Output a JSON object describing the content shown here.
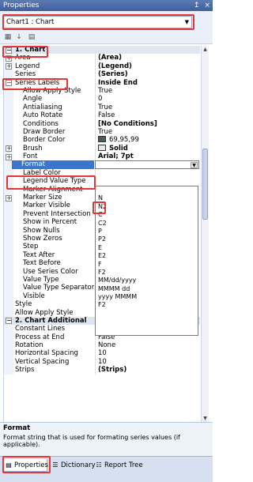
{
  "window": {
    "title": "Properties",
    "pin_glyph": "↥",
    "close_glyph": "×"
  },
  "object_selector": {
    "value": "Chart1 : Chart",
    "arrow_glyph": "▼"
  },
  "toolbar": {
    "icons": [
      "categorized-icon",
      "alphabetical-icon",
      "property-pages-icon"
    ]
  },
  "grid": {
    "rows": [
      {
        "kind": "category",
        "toggle": "−",
        "name": "1. Chart"
      },
      {
        "kind": "prop",
        "toggle": "+",
        "name": "Area",
        "value": "(Area)",
        "bold": true
      },
      {
        "kind": "prop",
        "toggle": "+",
        "name": "Legend",
        "value": "(Legend)",
        "bold": true
      },
      {
        "kind": "prop",
        "toggle": "",
        "name": "Series",
        "value": "(Series)",
        "bold": true
      },
      {
        "kind": "prop",
        "toggle": "−",
        "name": "Series Labels",
        "value": "Inside End",
        "bold": true
      },
      {
        "kind": "sub",
        "name": "Allow Apply Style",
        "value": "True"
      },
      {
        "kind": "sub",
        "name": "Angle",
        "value": "0"
      },
      {
        "kind": "sub",
        "name": "Antialiasing",
        "value": "True"
      },
      {
        "kind": "sub",
        "name": "Auto Rotate",
        "value": "False"
      },
      {
        "kind": "sub",
        "name": "Conditions",
        "value": "[No Conditions]",
        "bold": true
      },
      {
        "kind": "sub",
        "name": "Draw Border",
        "value": "True"
      },
      {
        "kind": "sub",
        "name": "Border Color",
        "value": "69,95,99",
        "swatch": "color"
      },
      {
        "kind": "sub",
        "toggle": "+",
        "name": "Brush",
        "value": "Solid",
        "swatch": "solid",
        "bold": true
      },
      {
        "kind": "sub",
        "toggle": "+",
        "name": "Font",
        "value": "Arial; 7pt",
        "bold": true
      },
      {
        "kind": "selected",
        "name": "Format",
        "value": "",
        "dropdown": "▼"
      },
      {
        "kind": "sub",
        "name": "Label Color",
        "value": ""
      },
      {
        "kind": "sub",
        "name": "Legend Value Type",
        "value": ""
      },
      {
        "kind": "sub",
        "name": "Marker Alignment",
        "value": ""
      },
      {
        "kind": "sub",
        "toggle": "+",
        "name": "Marker Size",
        "value": ""
      },
      {
        "kind": "sub",
        "name": "Marker Visible",
        "value": ""
      },
      {
        "kind": "sub",
        "name": "Prevent Intersection",
        "value": ""
      },
      {
        "kind": "sub",
        "name": "Show in Percent",
        "value": ""
      },
      {
        "kind": "sub",
        "name": "Show Nulls",
        "value": ""
      },
      {
        "kind": "sub",
        "name": "Show Zeros",
        "value": ""
      },
      {
        "kind": "sub",
        "name": "Step",
        "value": ""
      },
      {
        "kind": "sub",
        "name": "Text After",
        "value": ""
      },
      {
        "kind": "sub",
        "name": "Text Before",
        "value": ""
      },
      {
        "kind": "sub",
        "name": "Use Series Color",
        "value": ""
      },
      {
        "kind": "sub",
        "name": "Value Type",
        "value": ""
      },
      {
        "kind": "sub",
        "name": "Value Type Separator",
        "value": ""
      },
      {
        "kind": "sub",
        "name": "Visible",
        "value": ""
      },
      {
        "kind": "prop",
        "toggle": "",
        "name": "Style",
        "value": ""
      },
      {
        "kind": "prop",
        "toggle": "",
        "name": "Allow Apply Style",
        "value": ""
      },
      {
        "kind": "category",
        "toggle": "−",
        "name": "2. Chart  Additional"
      },
      {
        "kind": "prop",
        "toggle": "",
        "name": "Constant Lines",
        "value": "(Constant Lines)",
        "bold": true
      },
      {
        "kind": "prop",
        "toggle": "",
        "name": "Process at End",
        "value": "False"
      },
      {
        "kind": "prop",
        "toggle": "",
        "name": "Rotation",
        "value": "None"
      },
      {
        "kind": "prop",
        "toggle": "",
        "name": "Horizontal Spacing",
        "value": "10"
      },
      {
        "kind": "prop",
        "toggle": "",
        "name": "Vertical Spacing",
        "value": "10"
      },
      {
        "kind": "prop",
        "toggle": "",
        "name": "Strips",
        "value": "(Strips)",
        "bold": true
      }
    ]
  },
  "format_dropdown": {
    "options": [
      "",
      "N",
      "N2",
      "C",
      "C2",
      "P",
      "P2",
      "E",
      "E2",
      "F",
      "F2",
      "MM/dd/yyyy",
      "MMMM dd",
      "yyyy MMMM",
      "F2",
      "",
      "",
      ""
    ]
  },
  "description": {
    "title": "Format",
    "text": "Format string that is used for formating series values (if applicable)."
  },
  "tabs": [
    {
      "label": "Properties",
      "icon": "properties-icon",
      "glyph": "▤",
      "active": true
    },
    {
      "label": "Dictionary",
      "icon": "dictionary-icon",
      "glyph": "☰",
      "active": false
    },
    {
      "label": "Report Tree",
      "icon": "report-tree-icon",
      "glyph": "☷",
      "active": false
    }
  ],
  "colors": {
    "highlight": "#e53535",
    "selection": "#3b75cf",
    "titlebar": "#3d5f9e",
    "border_color_swatch": "#455d63"
  }
}
